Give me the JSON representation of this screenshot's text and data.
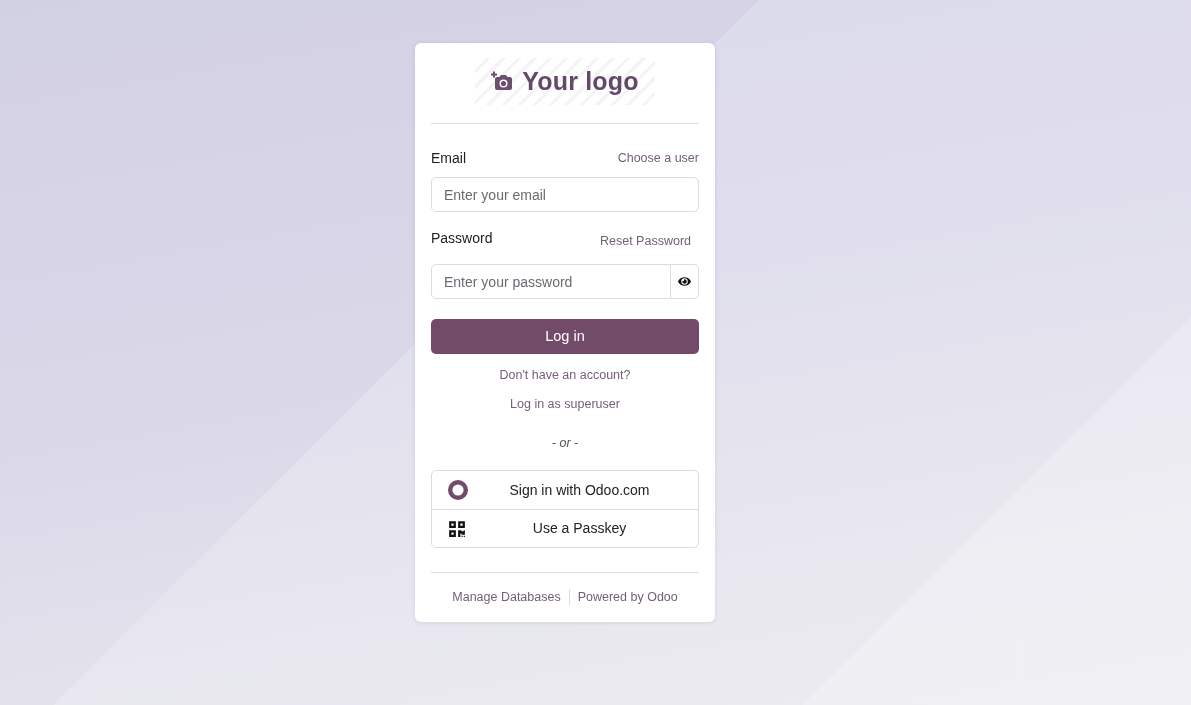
{
  "logo": {
    "text": "Your logo"
  },
  "form": {
    "email": {
      "label": "Email",
      "link": "Choose a user",
      "placeholder": "Enter your email"
    },
    "password": {
      "label": "Password",
      "link": "Reset Password",
      "placeholder": "Enter your password"
    },
    "submit": "Log in"
  },
  "links": [
    "Don't have an account?",
    "Log in as superuser"
  ],
  "separator": "- or -",
  "providers": [
    {
      "kind": "odoo",
      "label": "Sign in with Odoo.com"
    },
    {
      "kind": "passkey",
      "label": "Use a Passkey"
    }
  ],
  "footer": [
    "Manage Databases",
    "Powered by Odoo"
  ]
}
